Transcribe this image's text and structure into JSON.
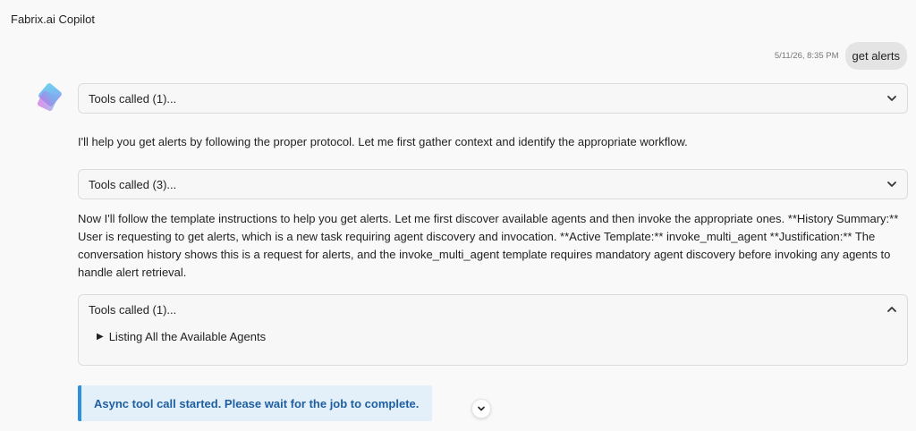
{
  "app": {
    "title": "Fabrix.ai Copilot"
  },
  "user_message": {
    "timestamp": "5/11/26, 8:35 PM",
    "text": "get alerts"
  },
  "assistant": {
    "tools_1": {
      "label": "Tools called (1)...",
      "state": "collapsed"
    },
    "message_1": "I'll help you get alerts by following the proper protocol. Let me first gather context and identify the appropriate workflow.",
    "tools_2": {
      "label": "Tools called (3)...",
      "state": "collapsed"
    },
    "message_2": "Now I'll follow the template instructions to help you get alerts. Let me first discover available agents and then invoke the appropriate ones. **History Summary:** User is requesting to get alerts, which is a new task requiring agent discovery and invocation. **Active Template:** invoke_multi_agent **Justification:** The conversation history shows this is a request for alerts, and the invoke_multi_agent template requires mandatory agent discovery before invoking any agents to handle alert retrieval.",
    "tools_3": {
      "label": "Tools called (1)...",
      "state": "expanded",
      "items": [
        {
          "label": "Listing All the Available Agents"
        }
      ]
    },
    "async_notice": "Async tool call started. Please wait for the job to complete."
  },
  "colors": {
    "accent": "#2e90dd",
    "notice_bg": "#e3f0fa",
    "notice_text": "#1f5fa0"
  },
  "icons": [
    "chevron-down-icon",
    "chevron-up-icon",
    "triangle-right-icon",
    "scroll-down-icon",
    "bot-avatar-icon"
  ]
}
